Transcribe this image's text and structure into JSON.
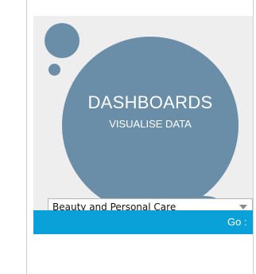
{
  "banner": {
    "title": "DASHBOARDS",
    "subtitle": "VISUALISE DATA"
  },
  "category_select": {
    "selected_value": "Beauty and Personal Care",
    "arrow_icon": "dropdown-triangle-icon"
  },
  "go_button": {
    "label": "Go :"
  },
  "colors": {
    "panel_background": "#eeeeee",
    "bubble": "#6a8ea8",
    "go_bar": "#0aa1d8"
  }
}
